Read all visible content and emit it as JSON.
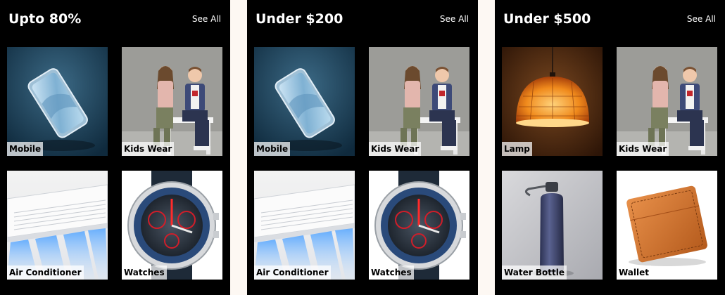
{
  "panels": [
    {
      "title": "Upto 80%",
      "see_all": "See All",
      "tiles": [
        {
          "label": "Mobile",
          "icon": "phone-icon"
        },
        {
          "label": "Kids Wear",
          "icon": "kids-photo-icon"
        },
        {
          "label": "Air Conditioner",
          "icon": "air-conditioner-icon"
        },
        {
          "label": "Watches",
          "icon": "watch-icon"
        }
      ]
    },
    {
      "title": "Under $200",
      "see_all": "See All",
      "tiles": [
        {
          "label": "Mobile",
          "icon": "phone-icon"
        },
        {
          "label": "Kids Wear",
          "icon": "kids-photo-icon"
        },
        {
          "label": "Air Conditioner",
          "icon": "air-conditioner-icon"
        },
        {
          "label": "Watches",
          "icon": "watch-icon"
        }
      ]
    },
    {
      "title": "Under $500",
      "see_all": "See All",
      "tiles": [
        {
          "label": "Lamp",
          "icon": "lamp-icon"
        },
        {
          "label": "Kids Wear",
          "icon": "kids-photo-icon"
        },
        {
          "label": "Water Bottle",
          "icon": "water-bottle-icon"
        },
        {
          "label": "Wallet",
          "icon": "wallet-icon"
        }
      ]
    }
  ]
}
